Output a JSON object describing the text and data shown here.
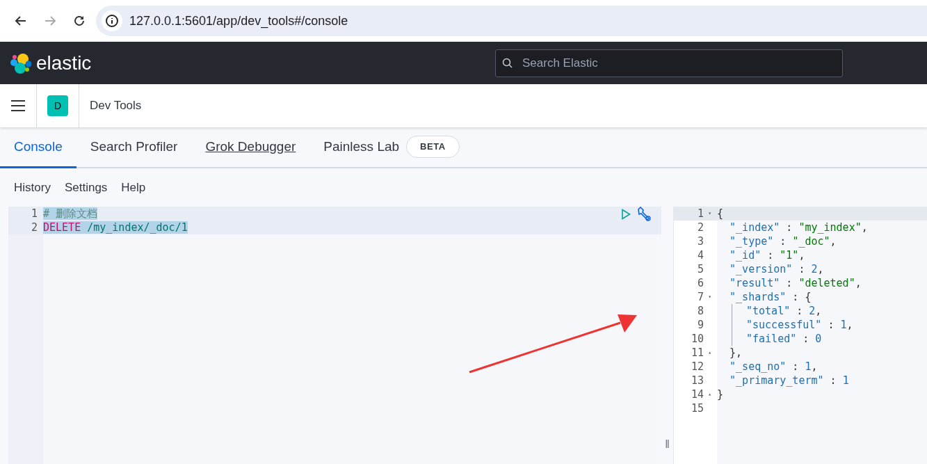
{
  "browser": {
    "url": "127.0.0.1:5601/app/dev_tools#/console"
  },
  "header": {
    "logo_text": "elastic",
    "search": {
      "placeholder": "Search Elastic"
    }
  },
  "breadcrumb": {
    "avatar_letter": "D",
    "title": "Dev Tools"
  },
  "tabs": [
    {
      "label": "Console",
      "selected": true,
      "hovered": false
    },
    {
      "label": "Search Profiler",
      "selected": false,
      "hovered": false
    },
    {
      "label": "Grok Debugger",
      "selected": false,
      "hovered": true
    },
    {
      "label": "Painless Lab",
      "selected": false,
      "hovered": false,
      "badge": "BETA"
    }
  ],
  "menu": [
    "History",
    "Settings",
    "Help"
  ],
  "editor": {
    "lines": [
      {
        "number": "1",
        "selected": true,
        "tokens": [
          {
            "kind": "comment",
            "text": "# 删除文档"
          }
        ]
      },
      {
        "number": "2",
        "selected": true,
        "tokens": [
          {
            "kind": "method",
            "text": "DELETE"
          },
          {
            "kind": "url",
            "text": " /my_index/_doc/1"
          }
        ]
      }
    ]
  },
  "response": {
    "lines": [
      {
        "number": "1",
        "fold": "▾",
        "guide": false,
        "tokens": [
          {
            "kind": "punct",
            "text": "{"
          }
        ]
      },
      {
        "number": "2",
        "guide": false,
        "tokens": [
          {
            "kind": "key",
            "text": "  \"_index\""
          },
          {
            "kind": "punct",
            "text": " : "
          },
          {
            "kind": "string",
            "text": "\"my_index\""
          },
          {
            "kind": "punct",
            "text": ","
          }
        ]
      },
      {
        "number": "3",
        "guide": false,
        "tokens": [
          {
            "kind": "key",
            "text": "  \"_type\""
          },
          {
            "kind": "punct",
            "text": " : "
          },
          {
            "kind": "string",
            "text": "\"_doc\""
          },
          {
            "kind": "punct",
            "text": ","
          }
        ]
      },
      {
        "number": "4",
        "guide": false,
        "tokens": [
          {
            "kind": "key",
            "text": "  \"_id\""
          },
          {
            "kind": "punct",
            "text": " : "
          },
          {
            "kind": "string",
            "text": "\"1\""
          },
          {
            "kind": "punct",
            "text": ","
          }
        ]
      },
      {
        "number": "5",
        "guide": false,
        "tokens": [
          {
            "kind": "key",
            "text": "  \"_version\""
          },
          {
            "kind": "punct",
            "text": " : "
          },
          {
            "kind": "number",
            "text": "2"
          },
          {
            "kind": "punct",
            "text": ","
          }
        ]
      },
      {
        "number": "6",
        "guide": false,
        "tokens": [
          {
            "kind": "key",
            "text": "  \"result\""
          },
          {
            "kind": "punct",
            "text": " : "
          },
          {
            "kind": "string",
            "text": "\"deleted\""
          },
          {
            "kind": "punct",
            "text": ","
          }
        ]
      },
      {
        "number": "7",
        "fold": "▾",
        "guide": false,
        "tokens": [
          {
            "kind": "key",
            "text": "  \"_shards\""
          },
          {
            "kind": "punct",
            "text": " : {"
          }
        ]
      },
      {
        "number": "8",
        "guide": true,
        "tokens": [
          {
            "kind": "key",
            "text": "\"total\""
          },
          {
            "kind": "punct",
            "text": " : "
          },
          {
            "kind": "number",
            "text": "2"
          },
          {
            "kind": "punct",
            "text": ","
          }
        ]
      },
      {
        "number": "9",
        "guide": true,
        "tokens": [
          {
            "kind": "key",
            "text": "\"successful\""
          },
          {
            "kind": "punct",
            "text": " : "
          },
          {
            "kind": "number",
            "text": "1"
          },
          {
            "kind": "punct",
            "text": ","
          }
        ]
      },
      {
        "number": "10",
        "guide": true,
        "tokens": [
          {
            "kind": "key",
            "text": "\"failed\""
          },
          {
            "kind": "punct",
            "text": " : "
          },
          {
            "kind": "number",
            "text": "0"
          }
        ]
      },
      {
        "number": "11",
        "fold": "▴",
        "guide": false,
        "tokens": [
          {
            "kind": "punct",
            "text": "  },"
          }
        ]
      },
      {
        "number": "12",
        "guide": false,
        "tokens": [
          {
            "kind": "key",
            "text": "  \"_seq_no\""
          },
          {
            "kind": "punct",
            "text": " : "
          },
          {
            "kind": "number",
            "text": "1"
          },
          {
            "kind": "punct",
            "text": ","
          }
        ]
      },
      {
        "number": "13",
        "guide": false,
        "tokens": [
          {
            "kind": "key",
            "text": "  \"_primary_term\""
          },
          {
            "kind": "punct",
            "text": " : "
          },
          {
            "kind": "number",
            "text": "1"
          }
        ]
      },
      {
        "number": "14",
        "fold": "▴",
        "guide": false,
        "tokens": [
          {
            "kind": "punct",
            "text": "}"
          }
        ]
      },
      {
        "number": "15",
        "guide": false
      }
    ]
  },
  "resizer": {
    "grip": "‖"
  }
}
